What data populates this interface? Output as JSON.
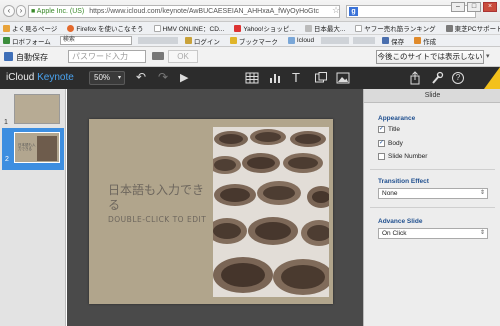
{
  "browser": {
    "site_label": "Apple Inc. (US)",
    "url": "https://www.icloud.com/keynote/AwBUCAESEIAN_AHHxaA_fWyOyHoGtc",
    "search_engine_letter": "g",
    "search_placeholder": ""
  },
  "bookmarks": [
    {
      "label": "よく見るページ",
      "color": "#e8a33b"
    },
    {
      "label": "Firefox を使いこなそう",
      "color": "#e4692c"
    },
    {
      "label": "HMV ONLINE：CD...",
      "color": "#c33"
    },
    {
      "label": "Yahoo!ショッピ...",
      "color": "#d33"
    },
    {
      "label": "日本最大...",
      "color": "#888"
    },
    {
      "label": "ヤフー売れ筋ランキング",
      "color": "#aaa"
    },
    {
      "label": "東芝PCサポート情報",
      "color": "#7a7a7a"
    }
  ],
  "addon_bar": {
    "lofi_label": "ロボフォーム",
    "search_label": "検索",
    "items": [
      "ログイン",
      "ブックマーク",
      "Icloud",
      "保存",
      "作成"
    ]
  },
  "autosave": {
    "label": "自動保存",
    "password_placeholder": "パスワード入力",
    "ok_label": "OK",
    "never_label": "今後このサイトでは表示しない",
    "caret": "▾"
  },
  "toolbar": {
    "brand": "iCloud",
    "app": "Keynote",
    "zoom": "50%",
    "zoom_caret": "▾",
    "undo_icon": "↶",
    "redo_icon": "↷",
    "play_icon": "▶",
    "table_icon": "table-icon",
    "chart_icon": "chart-icon",
    "text_icon": "T",
    "shape_icon": "shape-icon",
    "media_icon": "media-icon",
    "share_icon": "share-icon",
    "tools_icon": "wrench-icon",
    "help_icon": "?",
    "beta_label": "Beta"
  },
  "navigator": {
    "slides": [
      {
        "number": "1"
      },
      {
        "number": "2",
        "title": "日本語も入力できる"
      }
    ]
  },
  "slide": {
    "title": "日本語も入力できる",
    "body": "DOUBLE-CLICK TO EDIT"
  },
  "inspector": {
    "tab": "Slide",
    "appearance_heading": "Appearance",
    "checks": [
      {
        "label": "Title",
        "checked": true
      },
      {
        "label": "Body",
        "checked": true
      },
      {
        "label": "Slide Number",
        "checked": false
      }
    ],
    "transition_heading": "Transition Effect",
    "transition_value": "None",
    "advance_heading": "Advance Slide",
    "advance_value": "On Click"
  },
  "colors": {
    "accent": "#4aa3ef",
    "slide_bg": "#b1a58c",
    "selection": "#3d8ee0",
    "beta": "#f3c11b"
  }
}
